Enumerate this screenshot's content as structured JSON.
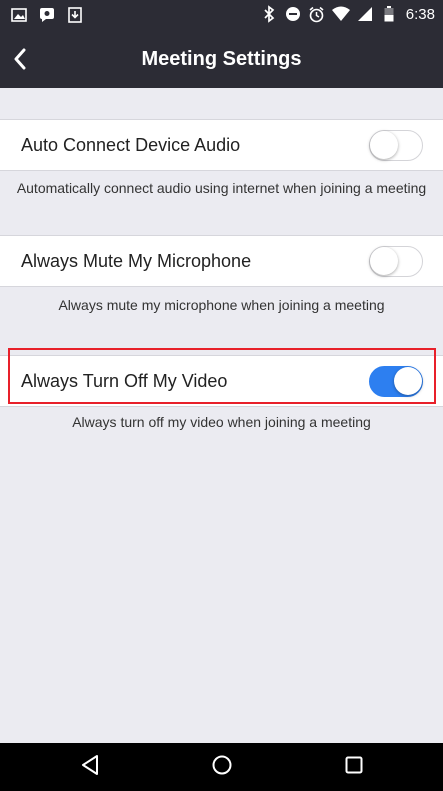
{
  "status_bar": {
    "time": "6:38",
    "icons": [
      "image-notification-icon",
      "chat-notification-icon",
      "download-notification-icon",
      "bluetooth-icon",
      "do-not-disturb-icon",
      "alarm-icon",
      "wifi-icon",
      "signal-icon",
      "battery-icon"
    ]
  },
  "header": {
    "title": "Meeting Settings",
    "back_icon": "chevron-left-icon"
  },
  "settings": [
    {
      "label": "Auto Connect Device Audio",
      "description": "Automatically connect audio using internet when joining a meeting",
      "enabled": false
    },
    {
      "label": "Always Mute My Microphone",
      "description": "Always mute my microphone when joining a meeting",
      "enabled": false
    },
    {
      "label": "Always Turn Off My Video",
      "description": "Always turn off my video when joining a meeting",
      "enabled": true
    }
  ],
  "colors": {
    "header_bg": "#2c2c35",
    "toggle_on": "#2d7ff0",
    "highlight": "#e8202a",
    "page_bg": "#ebebf1"
  },
  "system_nav": {
    "buttons": [
      "back-triangle-icon",
      "home-circle-icon",
      "recents-square-icon"
    ]
  }
}
